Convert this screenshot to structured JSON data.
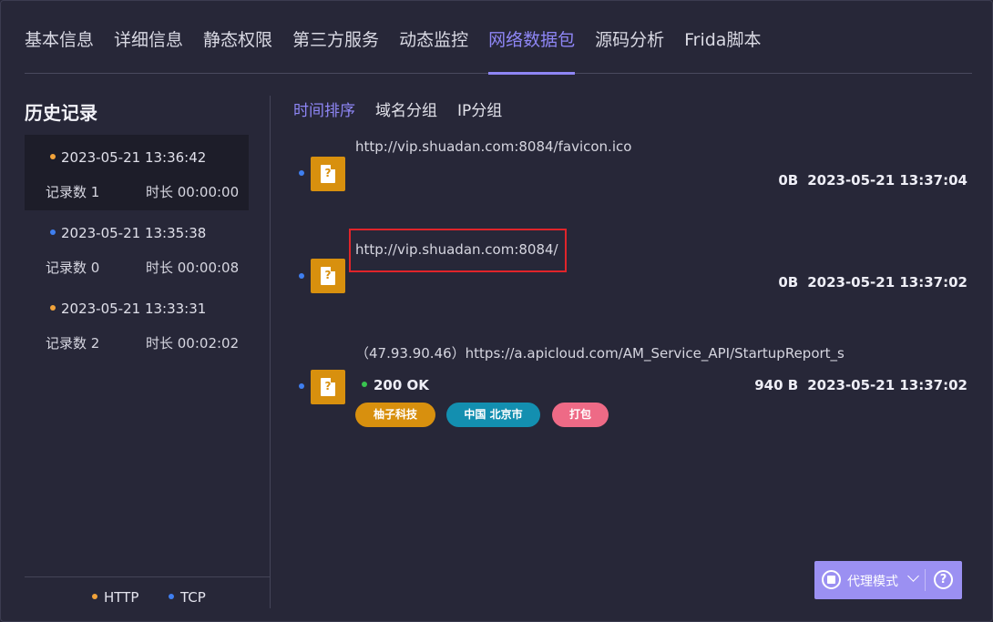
{
  "tabs": [
    "基本信息",
    "详细信息",
    "静态权限",
    "第三方服务",
    "动态监控",
    "网络数据包",
    "源码分析",
    "Frida脚本"
  ],
  "active_tab_index": 5,
  "history": {
    "title": "历史记录",
    "items": [
      {
        "time": "2023-05-21 13:36:42",
        "count": "记录数 1",
        "duration": "时长 00:00:00",
        "dot_color": "#f2a33a"
      },
      {
        "time": "2023-05-21 13:35:38",
        "count": "记录数 0",
        "duration": "时长 00:00:08",
        "dot_color": "#3f7ff0"
      },
      {
        "time": "2023-05-21 13:33:31",
        "count": "记录数 2",
        "duration": "时长 00:02:02",
        "dot_color": "#f2a33a"
      }
    ]
  },
  "legend": {
    "http": {
      "label": "HTTP",
      "color": "#f2a33a"
    },
    "tcp": {
      "label": "TCP",
      "color": "#3f7ff0"
    }
  },
  "subtabs": [
    "时间排序",
    "域名分组",
    "IP分组"
  ],
  "packets": [
    {
      "url": "http://vip.shuadan.com:8084/favicon.ico",
      "size": "0B",
      "time": "2023-05-21 13:37:04",
      "icon_glyph": "?"
    },
    {
      "url": "http://vip.shuadan.com:8084/",
      "size": "0B",
      "time": "2023-05-21 13:37:02",
      "icon_glyph": "?"
    },
    {
      "url": "（47.93.90.46）https://a.apicloud.com/AM_Service_API/StartupReport_s",
      "size": "940 B",
      "time": "2023-05-21 13:37:02",
      "icon_glyph": "?",
      "status": "200 OK",
      "tags": [
        {
          "label": "柚子科技",
          "color": "#d8900e"
        },
        {
          "label": "中国 北京市",
          "color": "#138fb0"
        },
        {
          "label": "打包",
          "color": "#ee6a86"
        }
      ]
    }
  ],
  "proxy": {
    "label": "代理模式",
    "help_glyph": "?"
  }
}
